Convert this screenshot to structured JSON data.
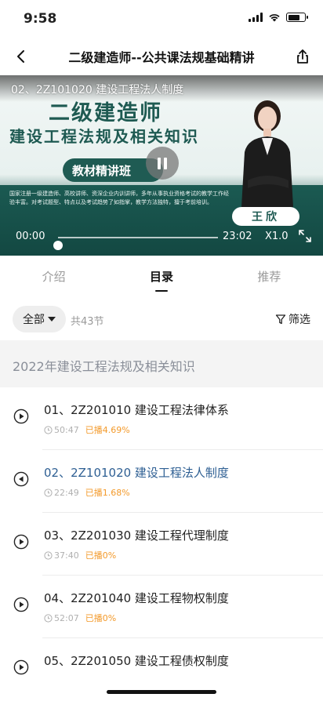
{
  "status_bar": {
    "time": "9:58"
  },
  "nav": {
    "title": "二级建造师--公共课法规基础精讲"
  },
  "video": {
    "caption": "02、2Z101020 建设工程法人制度",
    "poster_title": "二级建造师",
    "poster_subtitle": "建设工程法规及相关知识",
    "poster_badge": "教材精讲班",
    "poster_desc": "国家注册一级建造师、高校讲师、资深企业内训讲师，多年从事执业资格考试的教学工作经验丰富。对考试题型、特点以及考试趋势了如指掌，教学方法独特，擅于考前培训。",
    "teacher_name": "王欣",
    "current_time": "00:00",
    "total_time": "23:02",
    "speed": "X1.0",
    "progress": 0.0
  },
  "tabs": [
    {
      "label": "介绍"
    },
    {
      "label": "目录"
    },
    {
      "label": "推荐"
    }
  ],
  "filter": {
    "selected": "全部",
    "count": "共43节",
    "filter_label": "筛选"
  },
  "section": {
    "title": "2022年建设工程法规及相关知识"
  },
  "lessons": [
    {
      "title": "01、2Z201010 建设工程法律体系",
      "duration": "50:47",
      "progress": "已播4.69%"
    },
    {
      "title": "02、2Z101020 建设工程法人制度",
      "duration": "22:49",
      "progress": "已播1.68%"
    },
    {
      "title": "03、2Z201030 建设工程代理制度",
      "duration": "37:40",
      "progress": "已播0%"
    },
    {
      "title": "04、2Z201040 建设工程物权制度",
      "duration": "52:07",
      "progress": "已播0%"
    },
    {
      "title": "05、2Z201050 建设工程债权制度",
      "duration": "",
      "progress": ""
    }
  ],
  "colors": {
    "accent": "#2e5f93",
    "progress_text": "#f39a2b",
    "poster_green": "#1e5a52"
  }
}
